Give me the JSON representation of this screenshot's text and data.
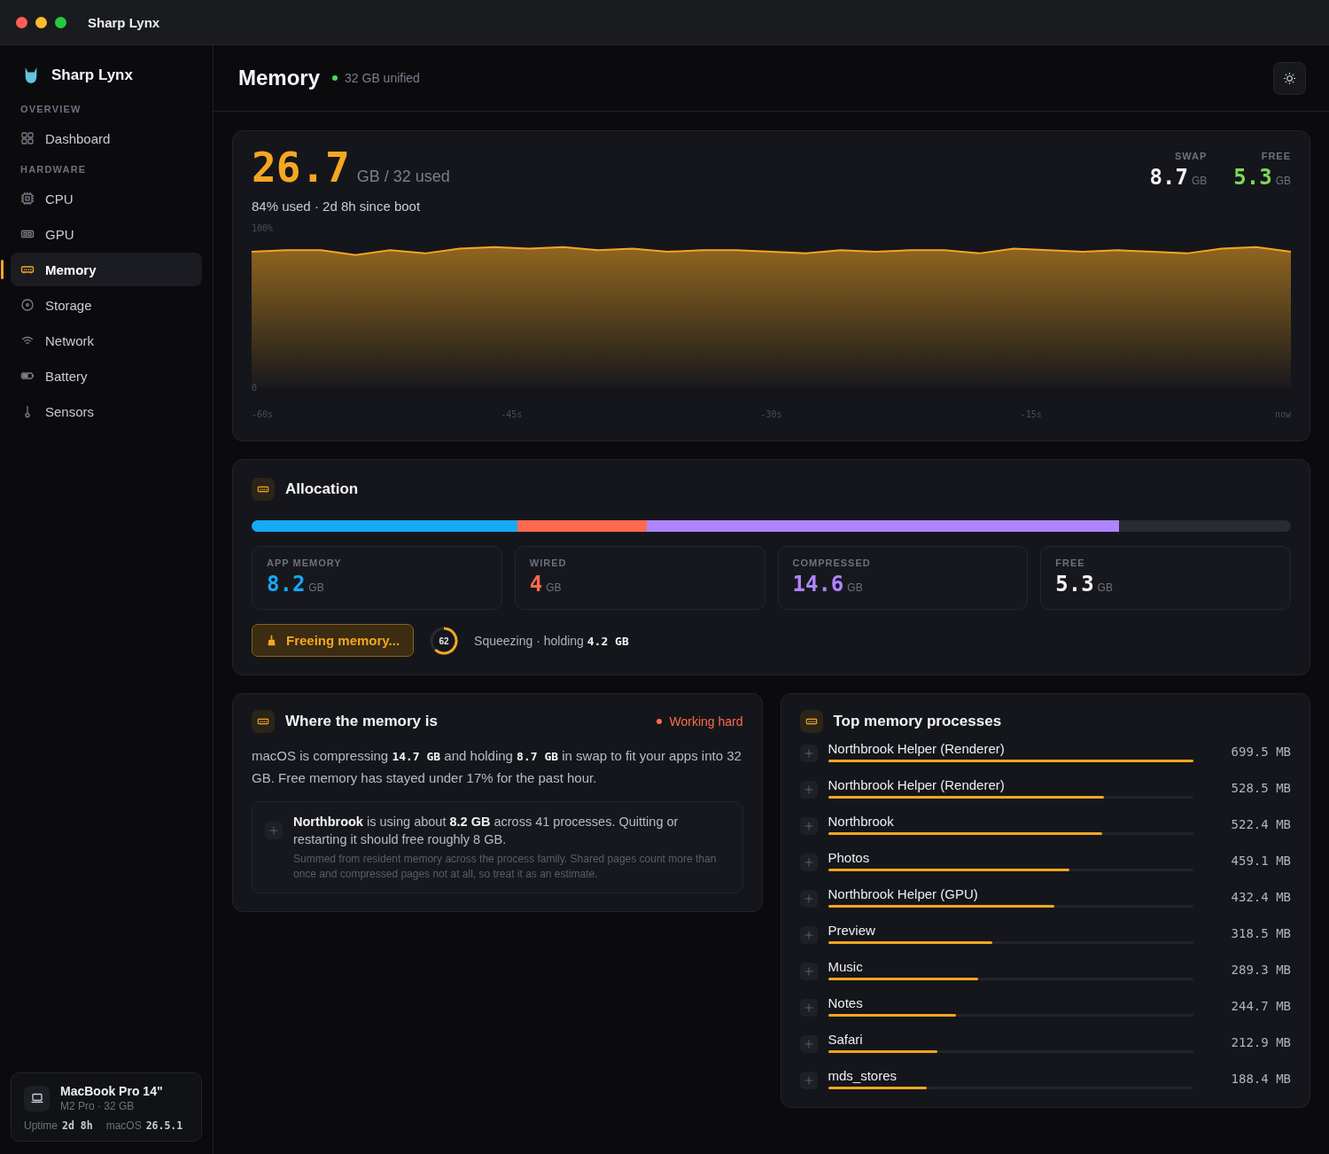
{
  "window": {
    "title": "Sharp Lynx"
  },
  "sidebar": {
    "app_name": "Sharp Lynx",
    "sections": [
      {
        "heading": "OVERVIEW",
        "items": [
          {
            "kind": "dashboard",
            "label": "Dashboard",
            "selected": false
          }
        ]
      },
      {
        "heading": "HARDWARE",
        "items": [
          {
            "kind": "cpu",
            "label": "CPU",
            "selected": false
          },
          {
            "kind": "gpu",
            "label": "GPU",
            "selected": false
          },
          {
            "kind": "memory",
            "label": "Memory",
            "selected": true
          },
          {
            "kind": "storage",
            "label": "Storage",
            "selected": false
          },
          {
            "kind": "network",
            "label": "Network",
            "selected": false
          },
          {
            "kind": "battery",
            "label": "Battery",
            "selected": false
          },
          {
            "kind": "sensors",
            "label": "Sensors",
            "selected": false
          }
        ]
      }
    ],
    "device": {
      "name": "MacBook Pro 14\"",
      "spec": "M2 Pro · 32 GB",
      "uptime_label": "Uptime",
      "uptime": "2d  8h",
      "os_label": "macOS",
      "os": "26.5.1"
    }
  },
  "header": {
    "title": "Memory",
    "subtitle": "32 GB unified"
  },
  "overview": {
    "value": "26.7",
    "unit": "GB / 32 used",
    "summary": "84% used · 2d 8h since boot",
    "stats": [
      {
        "label": "SWAP",
        "value": "8.7",
        "unit": "GB",
        "color": "#f2f2f4"
      },
      {
        "label": "FREE",
        "value": "5.3",
        "unit": "GB",
        "color": "#7ed957"
      }
    ],
    "chart_data": {
      "type": "area",
      "ylim": [
        0,
        100
      ],
      "yticks": [
        {
          "value": 100,
          "label": "100%"
        },
        {
          "value": 0,
          "label": "0"
        }
      ],
      "xlim": [
        -60,
        0
      ],
      "xticks": [
        {
          "value": -60,
          "label": "-60s"
        },
        {
          "value": -45,
          "label": "-45s"
        },
        {
          "value": -30,
          "label": "-30s"
        },
        {
          "value": -15,
          "label": "-15s"
        },
        {
          "value": 0,
          "label": "now"
        }
      ],
      "x": [
        -60,
        -58,
        -56,
        -54,
        -52,
        -50,
        -48,
        -46,
        -44,
        -42,
        -40,
        -38,
        -36,
        -34,
        -32,
        -30,
        -28,
        -26,
        -24,
        -22,
        -20,
        -18,
        -16,
        -14,
        -12,
        -10,
        -8,
        -6,
        -4,
        -2,
        0
      ],
      "series": [
        {
          "color": "#f5a623",
          "values": [
            85,
            86,
            86,
            83,
            86,
            84,
            87,
            88,
            87,
            88,
            86,
            87,
            85,
            86,
            86,
            85,
            84,
            86,
            85,
            86,
            86,
            84,
            87,
            86,
            85,
            86,
            85,
            84,
            87,
            88,
            85
          ]
        }
      ]
    }
  },
  "allocation": {
    "title": "Allocation",
    "cards": [
      {
        "label": "APP MEMORY",
        "value": "8.2",
        "unit": "GB",
        "color": "#16a9f5",
        "kind": "segment"
      },
      {
        "label": "WIRED",
        "value": "4",
        "unit": "GB",
        "color": "#ff6a4d",
        "kind": "segment"
      },
      {
        "label": "COMPRESSED",
        "value": "14.6",
        "unit": "GB",
        "color": "#ae84ff",
        "kind": "segment"
      },
      {
        "label": "FREE",
        "value": "5.3",
        "unit": "GB",
        "color": "#f2f2f4",
        "kind": "remainder"
      }
    ],
    "button": "Freeing memory...",
    "gauge": {
      "text": "62"
    },
    "status": "Squeezing · holding **4.2 GB**"
  },
  "where": {
    "title": "Where the memory is",
    "badge": "Working hard",
    "text": "macOS is compressing **14.7 GB** and holding **8.7 GB** in swap to fit your apps into 32 GB. Free memory has stayed under 17% for the past hour.",
    "note": {
      "text": "**Northbrook** is using about **8.2 GB** across 41 processes. Quitting or restarting it should free roughly 8 GB.",
      "detail": "Summed from resident memory across the process family. Shared pages count more than once and compressed pages not at all, so treat it as an estimate."
    }
  },
  "processes": {
    "title": "Top memory processes",
    "rows": [
      {
        "name": "Northbrook Helper (Renderer)",
        "level": 1.0,
        "size": "699.5 MB"
      },
      {
        "name": "Northbrook Helper (Renderer)",
        "level": 0.755,
        "size": "528.5 MB"
      },
      {
        "name": "Northbrook",
        "level": 0.75,
        "size": "522.4 MB"
      },
      {
        "name": "Photos",
        "level": 0.66,
        "size": "459.1 MB"
      },
      {
        "name": "Northbrook Helper (GPU)",
        "level": 0.62,
        "size": "432.4 MB"
      },
      {
        "name": "Preview",
        "level": 0.45,
        "size": "318.5 MB"
      },
      {
        "name": "Music",
        "level": 0.41,
        "size": "289.3 MB"
      },
      {
        "name": "Notes",
        "level": 0.35,
        "size": "244.7 MB"
      },
      {
        "name": "Safari",
        "level": 0.3,
        "size": "212.9 MB"
      },
      {
        "name": "mds_stores",
        "level": 0.27,
        "size": "188.4 MB"
      }
    ]
  }
}
